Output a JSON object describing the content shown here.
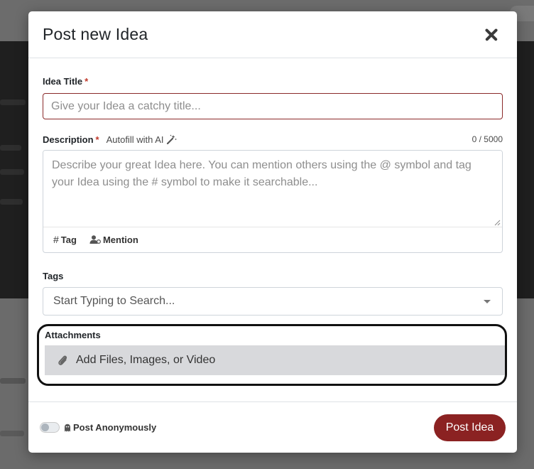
{
  "modal": {
    "title": "Post new Idea",
    "close_icon": "close-icon"
  },
  "idea_title": {
    "label": "Idea Title",
    "required_mark": "*",
    "value": "",
    "placeholder": "Give your Idea a catchy title..."
  },
  "description": {
    "label": "Description",
    "required_mark": "*",
    "autofill_label": "Autofill with AI",
    "autofill_icon": "magic-wand-icon",
    "counter": "0 / 5000",
    "value": "",
    "placeholder": "Describe your great Idea here. You can mention others using the @ symbol and tag your Idea using the # symbol to make it searchable...",
    "tools": {
      "tag_symbol": "#",
      "tag_label": "Tag",
      "mention_icon": "user-mention-icon",
      "mention_label": "Mention"
    }
  },
  "tags": {
    "label": "Tags",
    "placeholder": "Start Typing to Search..."
  },
  "attachments": {
    "label": "Attachments",
    "button_label": "Add Files, Images, or Video",
    "icon": "paperclip-icon"
  },
  "footer": {
    "anonymous_label": "Post Anonymously",
    "anonymous_icon": "ghost-icon",
    "anonymous_on": false,
    "submit_label": "Post Idea"
  },
  "colors": {
    "primary": "#8b2222",
    "required": "#c0392b",
    "attach_bg": "#d8d9dc"
  }
}
